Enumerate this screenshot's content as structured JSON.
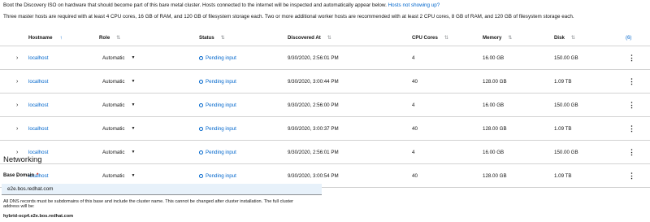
{
  "intro": {
    "line1": "Boot the Discovery ISO on hardware that should become part of this bare metal cluster. Hosts connected to the internet will be inspected and automatically appear below.",
    "link": "Hosts not showing up?",
    "line2": "Three master hosts are required with at least 4 CPU cores, 16 GB of RAM, and 120 GB of filesystem storage each. Two or more additional worker hosts are recommended with at least 2 CPU cores, 8 GB of RAM, and 120 GB of filesystem storage each."
  },
  "table": {
    "headers": {
      "hostname": "Hostname",
      "role": "Role",
      "status": "Status",
      "discovered": "Discovered At",
      "cpu": "CPU Cores",
      "memory": "Memory",
      "disk": "Disk",
      "count": "(6)"
    },
    "rows": [
      {
        "hostname": "localhost",
        "role": "Automatic",
        "status": "Pending input",
        "discovered": "9/30/2020, 2:56:01 PM",
        "cpu": "4",
        "memory": "16.00 GB",
        "disk": "150.00 GB"
      },
      {
        "hostname": "localhost",
        "role": "Automatic",
        "status": "Pending input",
        "discovered": "9/30/2020, 3:00:44 PM",
        "cpu": "40",
        "memory": "128.00 GB",
        "disk": "1.09 TB"
      },
      {
        "hostname": "localhost",
        "role": "Automatic",
        "status": "Pending input",
        "discovered": "9/30/2020, 2:56:00 PM",
        "cpu": "4",
        "memory": "16.00 GB",
        "disk": "150.00 GB"
      },
      {
        "hostname": "localhost",
        "role": "Automatic",
        "status": "Pending input",
        "discovered": "9/30/2020, 3:00:37 PM",
        "cpu": "40",
        "memory": "128.00 GB",
        "disk": "1.09 TB"
      },
      {
        "hostname": "localhost",
        "role": "Automatic",
        "status": "Pending input",
        "discovered": "9/30/2020, 2:56:01 PM",
        "cpu": "4",
        "memory": "16.00 GB",
        "disk": "150.00 GB"
      },
      {
        "hostname": "localhost",
        "role": "Automatic",
        "status": "Pending input",
        "discovered": "9/30/2020, 3:00:54 PM",
        "cpu": "40",
        "memory": "128.00 GB",
        "disk": "1.09 TB"
      }
    ]
  },
  "networking": {
    "title": "Networking",
    "base_domain_label": "Base Domain",
    "required_mark": "*",
    "base_domain_value": "e2e.bos.redhat.com",
    "help_line1": "All DNS records must be subdomains of this base and include the cluster name. This cannot be changed after cluster installation. The full cluster",
    "help_line2": "address will be:",
    "full_address": "hybrid-ocp4.e2e.bos.redhat.com"
  },
  "colors": {
    "link": "#0066cc",
    "required": "#c9190b",
    "input_bg": "#e7f1fa",
    "border": "#d2d2d2"
  }
}
